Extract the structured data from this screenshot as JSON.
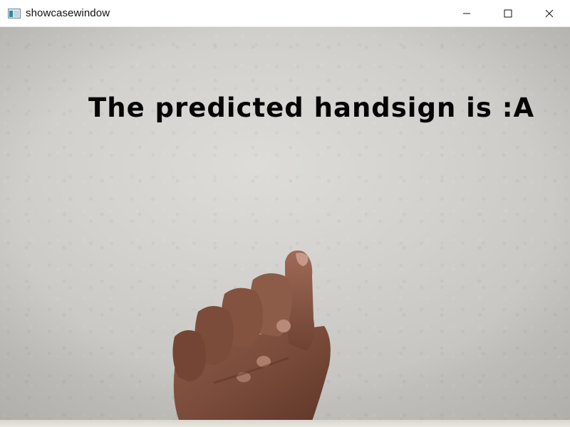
{
  "window": {
    "title": "showcasewindow",
    "icon": "app-window-icon",
    "controls": [
      "minimize-icon",
      "maximize-icon",
      "close-icon"
    ]
  },
  "frame": {
    "overlay_text": "The predicted handsign is :A",
    "overlay_color": "#000000"
  }
}
